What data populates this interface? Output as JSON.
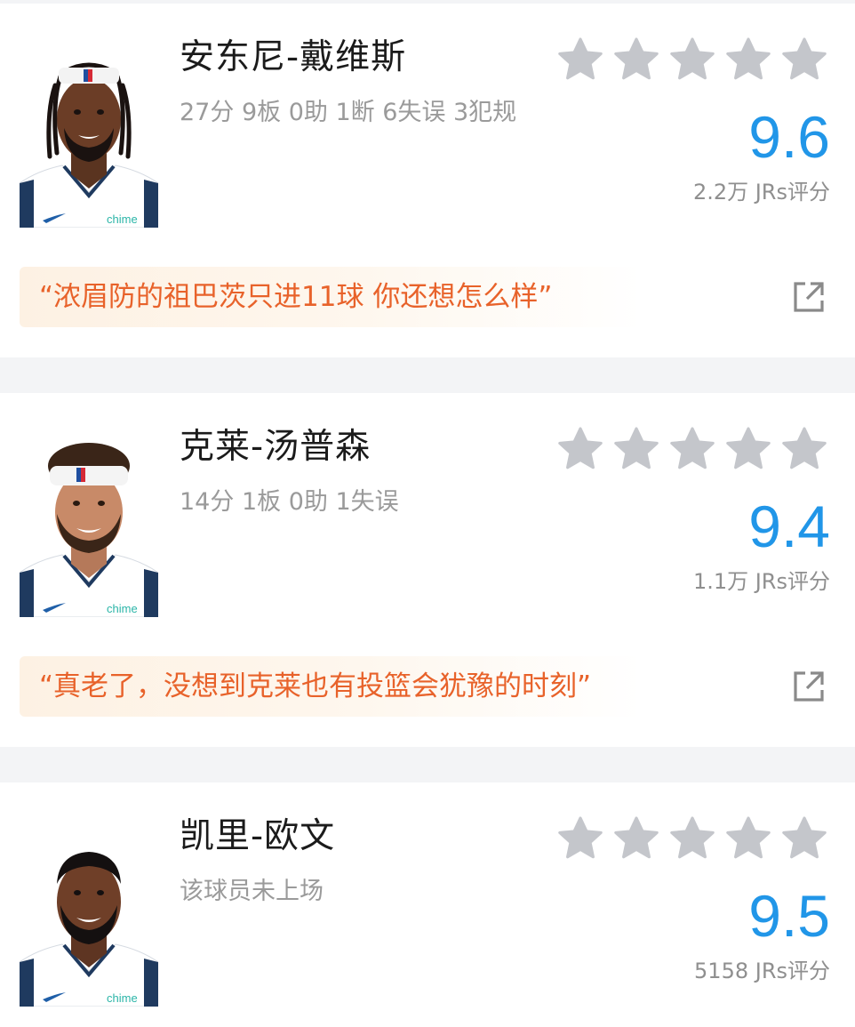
{
  "colors": {
    "accent_score": "#2196e8",
    "quote_text": "#e8622a",
    "quote_bg": "#fdf1e3",
    "star_inactive": "#c4c6cb",
    "jersey_navy": "#1f3a5f",
    "chime_teal": "#2bb5a8"
  },
  "icons": {
    "star": "star-icon",
    "share": "share-external-icon"
  },
  "players": [
    {
      "name": "安东尼-戴维斯",
      "stats": "27分 9板 0助 1断 6失误 3犯规",
      "rating_stars_filled": 0,
      "score": "9.6",
      "votes": "2.2万 JRs评分",
      "quote": "“浓眉防的祖巴茨只进11球 你还想怎么样”",
      "jersey_sponsor": "chime"
    },
    {
      "name": "克莱-汤普森",
      "stats": "14分 1板 0助 1失误",
      "rating_stars_filled": 0,
      "score": "9.4",
      "votes": "1.1万 JRs评分",
      "quote": "“真老了，没想到克莱也有投篮会犹豫的时刻”",
      "jersey_sponsor": "chime"
    },
    {
      "name": "凯里-欧文",
      "stats": "该球员未上场",
      "rating_stars_filled": 0,
      "score": "9.5",
      "votes": "5158 JRs评分",
      "jersey_sponsor": "chime"
    }
  ]
}
